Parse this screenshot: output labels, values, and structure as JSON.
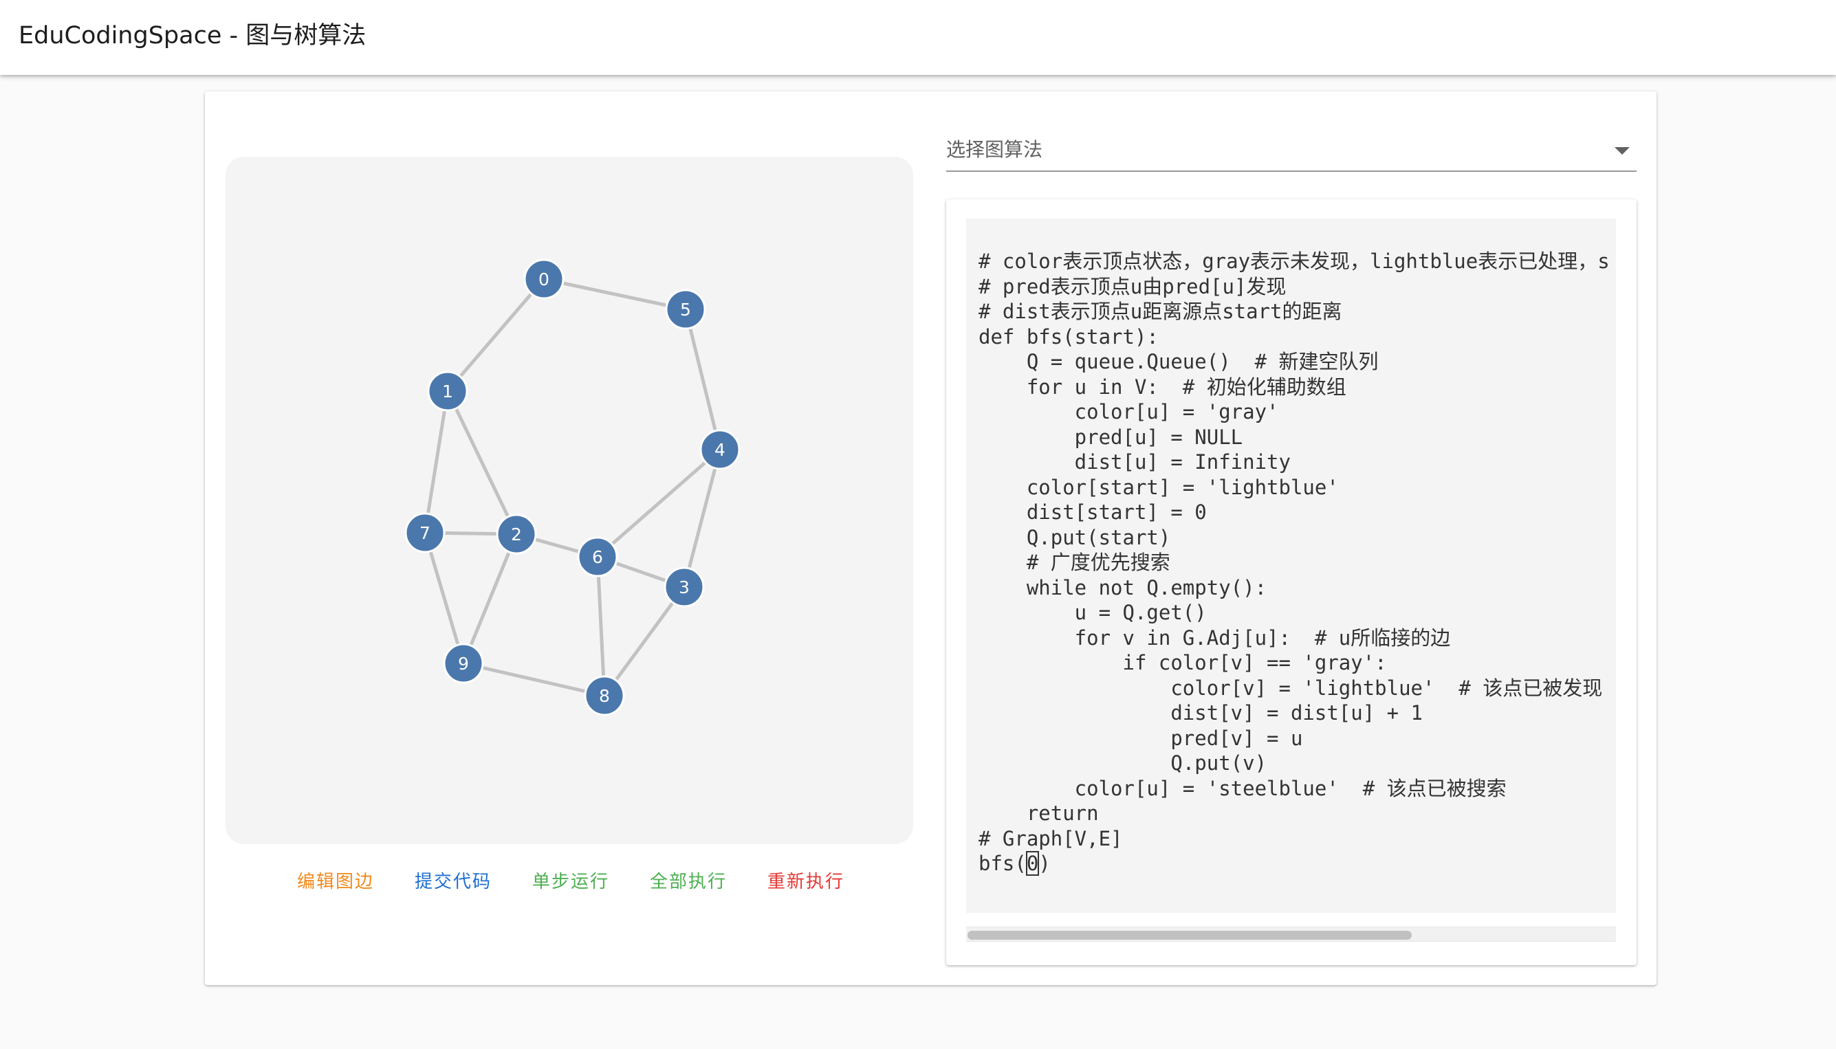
{
  "app": {
    "title": "EduCodingSpace - 图与树算法"
  },
  "algorithm_select": {
    "placeholder": "选择图算法"
  },
  "actions": {
    "edit_edges": "编辑图边",
    "submit_code": "提交代码",
    "step_run": "单步运行",
    "run_all": "全部执行",
    "restart": "重新执行"
  },
  "colors": {
    "node_fill": "#4b78ac",
    "edge_stroke": "#c2c2c2",
    "edit_edges": "#f08a1c",
    "submit_code": "#1e6fd0",
    "step_run": "#4caf50",
    "run_all": "#4caf50",
    "restart": "#e53935"
  },
  "graph": {
    "nodes": [
      "0",
      "1",
      "2",
      "3",
      "4",
      "5",
      "6",
      "7",
      "8",
      "9"
    ],
    "edges": [
      [
        "0",
        "5"
      ],
      [
        "0",
        "1"
      ],
      [
        "5",
        "4"
      ],
      [
        "1",
        "7"
      ],
      [
        "1",
        "2"
      ],
      [
        "4",
        "6"
      ],
      [
        "4",
        "3"
      ],
      [
        "7",
        "2"
      ],
      [
        "7",
        "9"
      ],
      [
        "2",
        "6"
      ],
      [
        "2",
        "9"
      ],
      [
        "6",
        "3"
      ],
      [
        "6",
        "8"
      ],
      [
        "3",
        "8"
      ],
      [
        "9",
        "8"
      ]
    ]
  },
  "code": {
    "lines": [
      "# color表示顶点状态，gray表示未发现，lightblue表示已处理，s",
      "# pred表示顶点u由pred[u]发现",
      "# dist表示顶点u距离源点start的距离",
      "def bfs(start):",
      "    Q = queue.Queue()  # 新建空队列",
      "    for u in V:  # 初始化辅助数组",
      "        color[u] = 'gray'",
      "        pred[u] = NULL",
      "        dist[u] = Infinity",
      "    color[start] = 'lightblue'",
      "    dist[start] = 0",
      "    Q.put(start)",
      "    # 广度优先搜索",
      "    while not Q.empty():",
      "        u = Q.get()",
      "        for v in G.Adj[u]:  # u所临接的边",
      "            if color[v] == 'gray':",
      "                color[v] = 'lightblue'  # 该点已被发现",
      "                dist[v] = dist[u] + 1",
      "                pred[v] = u",
      "                Q.put(v)",
      "        color[u] = 'steelblue'  # 该点已被搜索",
      "    return",
      "# Graph[V,E]"
    ],
    "call_prefix": "bfs(",
    "call_arg": "0",
    "call_suffix": ")"
  }
}
